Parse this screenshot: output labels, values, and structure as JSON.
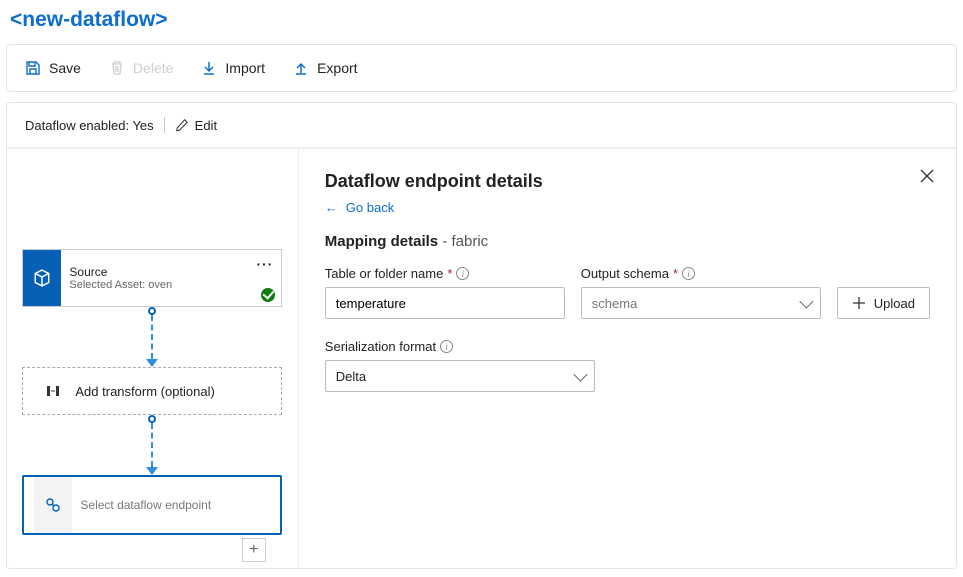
{
  "title": "<new-dataflow>",
  "toolbar": {
    "save": "Save",
    "delete": "Delete",
    "import": "Import",
    "export": "Export"
  },
  "status": {
    "label": "Dataflow enabled: Yes",
    "edit": "Edit"
  },
  "canvas": {
    "source": {
      "title": "Source",
      "sub": "Selected Asset: oven"
    },
    "transform": "Add transform (optional)",
    "endpoint": "Select dataflow endpoint"
  },
  "details": {
    "heading": "Dataflow endpoint details",
    "goback": "Go back",
    "mapping_title": "Mapping details",
    "mapping_sub": "- fabric",
    "table_label": "Table or folder name",
    "table_value": "temperature",
    "schema_label": "Output schema",
    "schema_placeholder": "schema",
    "upload": "Upload",
    "serial_label": "Serialization format",
    "serial_value": "Delta"
  }
}
